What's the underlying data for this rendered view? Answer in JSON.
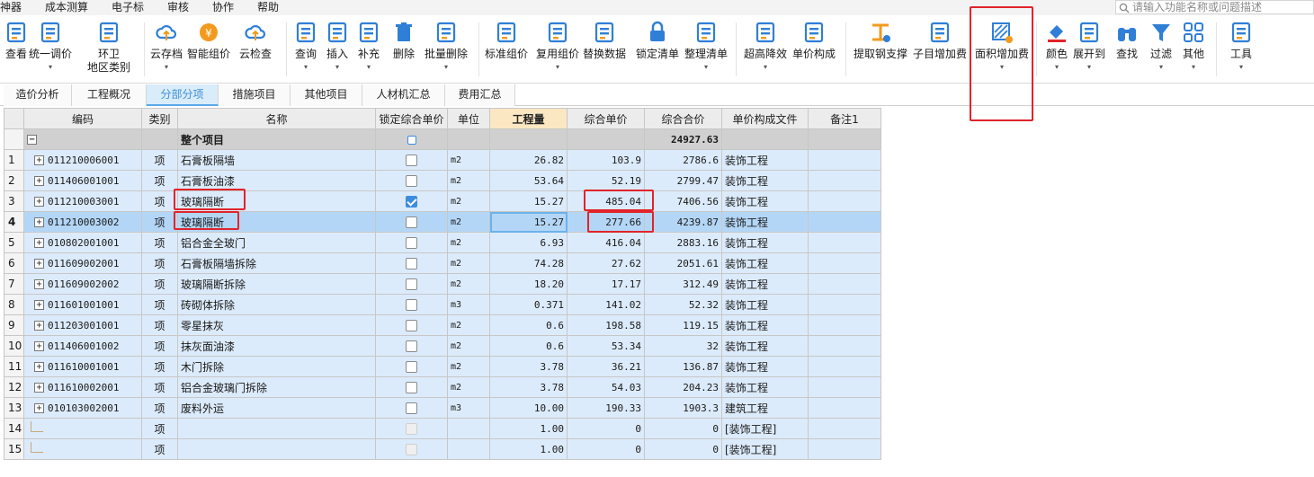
{
  "menu": [
    "神器",
    "成本测算",
    "电子标",
    "审核",
    "协作",
    "帮助"
  ],
  "search": {
    "placeholder": "请输入功能名称或问题描述"
  },
  "ribbon": [
    {
      "key": "view",
      "label": "查看",
      "icon": "view-icon",
      "dropdown": false
    },
    {
      "key": "unify-price",
      "label": "统一调价",
      "icon": "unify-price-icon",
      "dropdown": true
    },
    {
      "key": "env-region",
      "label": "环卫\n地区类别",
      "icon": "region-icon",
      "dropdown": false
    },
    {
      "key": "cloud-save",
      "label": "云存档",
      "icon": "cloud-upload-icon",
      "dropdown": true
    },
    {
      "key": "smart-price",
      "label": "智能组价",
      "icon": "smart-price-icon",
      "dropdown": false
    },
    {
      "key": "cloud-check",
      "label": "云检查",
      "icon": "cloud-check-icon",
      "dropdown": false
    },
    {
      "key": "query",
      "label": "查询",
      "icon": "query-icon",
      "dropdown": true
    },
    {
      "key": "insert",
      "label": "插入",
      "icon": "insert-icon",
      "dropdown": true
    },
    {
      "key": "supplement",
      "label": "补充",
      "icon": "supplement-icon",
      "dropdown": true
    },
    {
      "key": "delete",
      "label": "删除",
      "icon": "trash-icon",
      "dropdown": false
    },
    {
      "key": "batch-delete",
      "label": "批量删除",
      "icon": "batch-delete-icon",
      "dropdown": true
    },
    {
      "key": "standard-price",
      "label": "标准组价",
      "icon": "standard-price-icon",
      "dropdown": false
    },
    {
      "key": "reuse-price",
      "label": "复用组价",
      "icon": "reuse-price-icon",
      "dropdown": true
    },
    {
      "key": "replace-data",
      "label": "替换数据",
      "icon": "replace-data-icon",
      "dropdown": false
    },
    {
      "key": "lock-list",
      "label": "锁定清单",
      "icon": "lock-icon",
      "dropdown": false
    },
    {
      "key": "tidy-list",
      "label": "整理清单",
      "icon": "tidy-list-icon",
      "dropdown": true
    },
    {
      "key": "super-high",
      "label": "超高降效",
      "icon": "super-high-icon",
      "dropdown": true
    },
    {
      "key": "unit-price-comp",
      "label": "单价构成",
      "icon": "unit-price-icon",
      "dropdown": false
    },
    {
      "key": "extract-steel",
      "label": "提取钢支撑",
      "icon": "steel-icon",
      "dropdown": false
    },
    {
      "key": "sub-add-fee",
      "label": "子目增加费",
      "icon": "sub-add-fee-icon",
      "dropdown": false
    },
    {
      "key": "area-add-fee",
      "label": "面积增加费",
      "icon": "area-add-fee-icon",
      "dropdown": true
    },
    {
      "key": "color",
      "label": "颜色",
      "icon": "paint-bucket-icon",
      "dropdown": true
    },
    {
      "key": "expand-to",
      "label": "展开到",
      "icon": "expand-to-icon",
      "dropdown": true
    },
    {
      "key": "find",
      "label": "查找",
      "icon": "binoculars-icon",
      "dropdown": false
    },
    {
      "key": "filter",
      "label": "过滤",
      "icon": "filter-icon",
      "dropdown": true
    },
    {
      "key": "other",
      "label": "其他",
      "icon": "grid-icon",
      "dropdown": true
    },
    {
      "key": "tools",
      "label": "工具",
      "icon": "tools-icon",
      "dropdown": true
    }
  ],
  "tabs": [
    {
      "label": "造价分析",
      "active": false
    },
    {
      "label": "工程概况",
      "active": false
    },
    {
      "label": "分部分项",
      "active": true
    },
    {
      "label": "措施项目",
      "active": false
    },
    {
      "label": "其他项目",
      "active": false
    },
    {
      "label": "人材机汇总",
      "active": false
    },
    {
      "label": "费用汇总",
      "active": false
    }
  ],
  "table": {
    "columns": [
      "编码",
      "类别",
      "名称",
      "锁定综合单价",
      "单位",
      "工程量",
      "综合单价",
      "综合合价",
      "单价构成文件",
      "备注1"
    ],
    "selected_column": 5,
    "group_row": {
      "name": "整个项目",
      "total": "24927.63"
    },
    "rows": [
      {
        "no": "1",
        "code": "011210006001",
        "type": "项",
        "name": "石膏板隔墙",
        "locked": false,
        "unit": "m2",
        "qty": "26.82",
        "price": "103.9",
        "total": "2786.6",
        "file": "装饰工程"
      },
      {
        "no": "2",
        "code": "011406001001",
        "type": "项",
        "name": "石膏板油漆",
        "locked": false,
        "unit": "m2",
        "qty": "53.64",
        "price": "52.19",
        "total": "2799.47",
        "file": "装饰工程"
      },
      {
        "no": "3",
        "code": "011210003001",
        "type": "项",
        "name": "玻璃隔断",
        "locked": true,
        "unit": "m2",
        "qty": "15.27",
        "price": "485.04",
        "total": "7406.56",
        "file": "装饰工程"
      },
      {
        "no": "4",
        "code": "011210003002",
        "type": "项",
        "name": "玻璃隔断",
        "locked": false,
        "unit": "m2",
        "qty": "15.27",
        "price": "277.66",
        "total": "4239.87",
        "file": "装饰工程",
        "current": true
      },
      {
        "no": "5",
        "code": "010802001001",
        "type": "项",
        "name": "铝合金全玻门",
        "locked": false,
        "unit": "m2",
        "qty": "6.93",
        "price": "416.04",
        "total": "2883.16",
        "file": "装饰工程"
      },
      {
        "no": "6",
        "code": "011609002001",
        "type": "项",
        "name": "石膏板隔墙拆除",
        "locked": false,
        "unit": "m2",
        "qty": "74.28",
        "price": "27.62",
        "total": "2051.61",
        "file": "装饰工程"
      },
      {
        "no": "7",
        "code": "011609002002",
        "type": "项",
        "name": "玻璃隔断拆除",
        "locked": false,
        "unit": "m2",
        "qty": "18.20",
        "price": "17.17",
        "total": "312.49",
        "file": "装饰工程"
      },
      {
        "no": "8",
        "code": "011601001001",
        "type": "项",
        "name": "砖砌体拆除",
        "locked": false,
        "unit": "m3",
        "qty": "0.371",
        "price": "141.02",
        "total": "52.32",
        "file": "装饰工程"
      },
      {
        "no": "9",
        "code": "011203001001",
        "type": "项",
        "name": "零星抹灰",
        "locked": false,
        "unit": "m2",
        "qty": "0.6",
        "price": "198.58",
        "total": "119.15",
        "file": "装饰工程"
      },
      {
        "no": "10",
        "code": "011406001002",
        "type": "项",
        "name": "抹灰面油漆",
        "locked": false,
        "unit": "m2",
        "qty": "0.6",
        "price": "53.34",
        "total": "32",
        "file": "装饰工程"
      },
      {
        "no": "11",
        "code": "011610001001",
        "type": "项",
        "name": "木门拆除",
        "locked": false,
        "unit": "m2",
        "qty": "3.78",
        "price": "36.21",
        "total": "136.87",
        "file": "装饰工程"
      },
      {
        "no": "12",
        "code": "011610002001",
        "type": "项",
        "name": "铝合金玻璃门拆除",
        "locked": false,
        "unit": "m2",
        "qty": "3.78",
        "price": "54.03",
        "total": "204.23",
        "file": "装饰工程"
      },
      {
        "no": "13",
        "code": "010103002001",
        "type": "项",
        "name": "废料外运",
        "locked": false,
        "unit": "m3",
        "qty": "10.00",
        "price": "190.33",
        "total": "1903.3",
        "file": "建筑工程"
      },
      {
        "no": "14",
        "code": "",
        "type": "项",
        "name": "",
        "locked": null,
        "unit": "",
        "qty": "1.00",
        "price": "0",
        "total": "0",
        "file": "[装饰工程]",
        "blank": true
      },
      {
        "no": "15",
        "code": "",
        "type": "项",
        "name": "",
        "locked": null,
        "unit": "",
        "qty": "1.00",
        "price": "0",
        "total": "0",
        "file": "[装饰工程]",
        "blank": true
      }
    ]
  },
  "colors": {
    "accent": "#3f8fd6",
    "row_bg": "#dcebfb",
    "current_row": "#b4d6f6",
    "highlight_red": "#e0242a",
    "group_row": "#d0d0d0"
  }
}
